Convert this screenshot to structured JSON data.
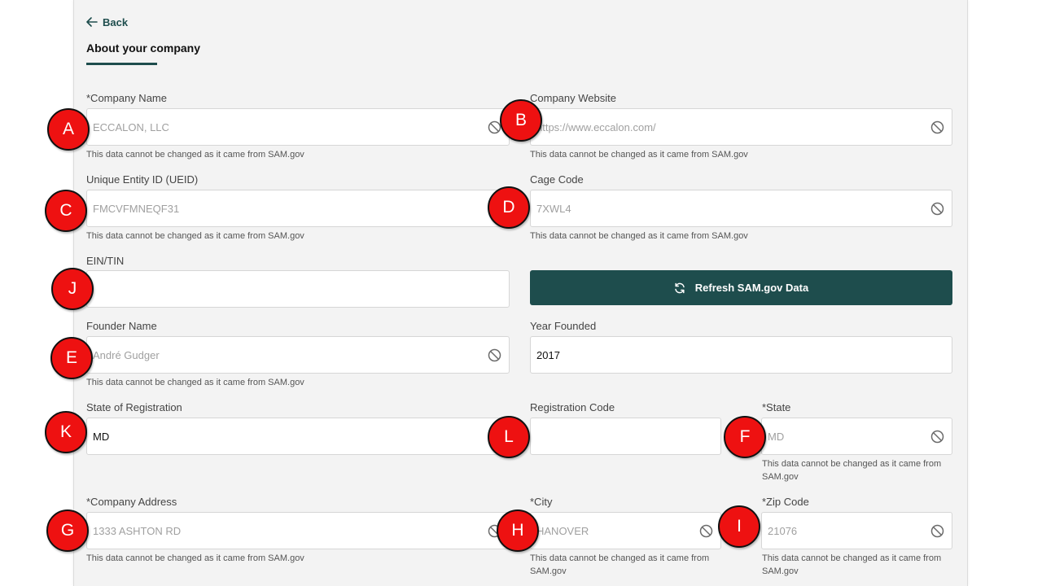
{
  "nav": {
    "back_label": "Back"
  },
  "page": {
    "title": "About your company"
  },
  "help_text": "This data cannot be changed as it came from SAM.gov",
  "fields": {
    "company_name": {
      "label": "*Company Name",
      "value": "ECCALON, LLC"
    },
    "company_website": {
      "label": "Company Website",
      "value": "https://www.eccalon.com/"
    },
    "ueid": {
      "label": "Unique Entity ID (UEID)",
      "value": "FMCVFMNEQF31"
    },
    "cage_code": {
      "label": "Cage Code",
      "value": "7XWL4"
    },
    "ein_tin": {
      "label": "EIN/TIN",
      "value": ""
    },
    "founder_name": {
      "label": "Founder Name",
      "value": "André Gudger"
    },
    "year_founded": {
      "label": "Year Founded",
      "value": "2017"
    },
    "state_of_registration": {
      "label": "State of Registration",
      "value": "MD"
    },
    "registration_code": {
      "label": "Registration Code",
      "value": ""
    },
    "state": {
      "label": "*State",
      "value": "MD"
    },
    "company_address": {
      "label": "*Company Address",
      "value": "1333 ASHTON RD"
    },
    "city": {
      "label": "*City",
      "value": "HANOVER"
    },
    "zip_code": {
      "label": "*Zip Code",
      "value": "21076"
    }
  },
  "refresh_button": {
    "label": "Refresh SAM.gov Data"
  },
  "markers": [
    "A",
    "B",
    "C",
    "D",
    "E",
    "F",
    "G",
    "H",
    "I",
    "J",
    "K",
    "L"
  ],
  "colors": {
    "accent": "#1e4d4d",
    "marker": "#ee1111",
    "panel_bg": "#f3f3f3"
  },
  "icons": {
    "back": "arrow-left-icon",
    "locked": "ban-icon",
    "refresh": "refresh-icon"
  }
}
